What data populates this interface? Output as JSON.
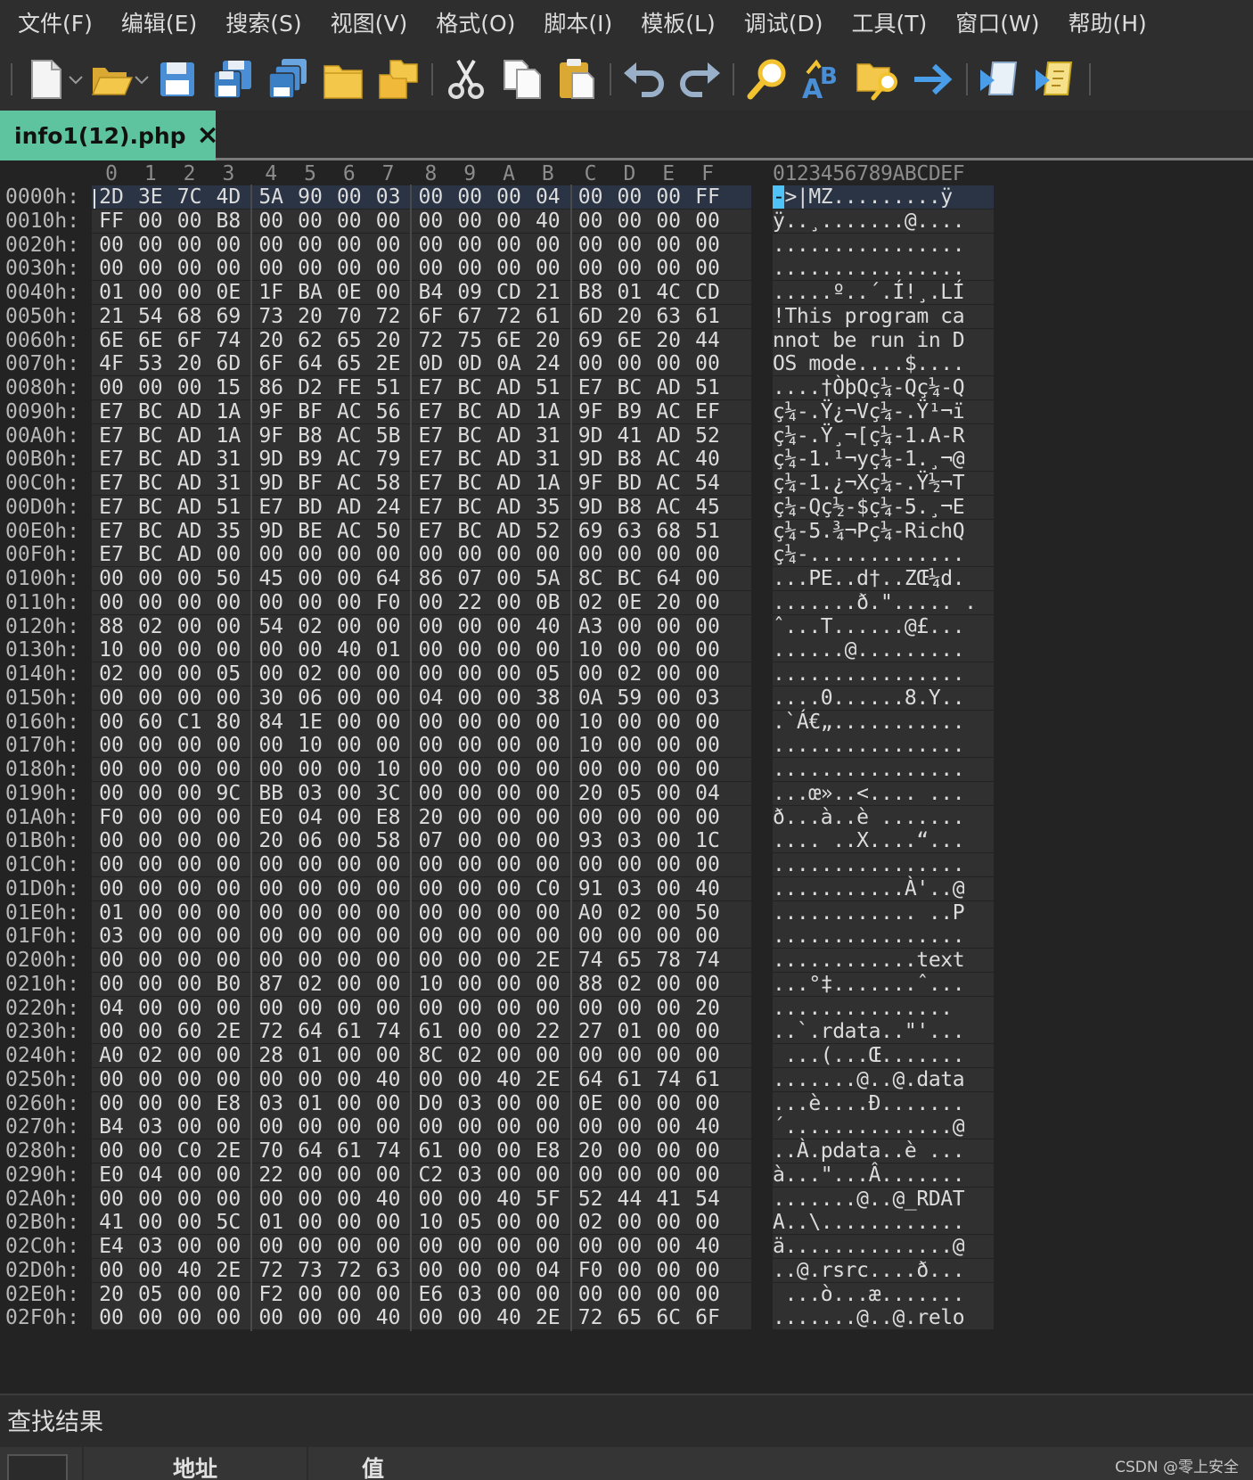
{
  "menu": [
    "文件(F)",
    "编辑(E)",
    "搜索(S)",
    "视图(V)",
    "格式(O)",
    "脚本(I)",
    "模板(L)",
    "调试(D)",
    "工具(T)",
    "窗口(W)",
    "帮助(H)"
  ],
  "toolbar": {
    "icons": [
      "new-file-icon",
      "open-folder-icon",
      "save-icon",
      "save-as-icon",
      "save-all-icon",
      "folder-icon",
      "open-project-icon",
      "cut-icon",
      "copy-icon",
      "paste-icon",
      "undo-icon",
      "redo-icon",
      "find-icon",
      "replace-icon",
      "find-in-files-icon",
      "goto-icon",
      "run-script-icon",
      "run-template-icon"
    ]
  },
  "tab": {
    "label": "info1(12).php",
    "close": "×"
  },
  "hex": {
    "col_headers": [
      "0",
      "1",
      "2",
      "3",
      "4",
      "5",
      "6",
      "7",
      "8",
      "9",
      "A",
      "B",
      "C",
      "D",
      "E",
      "F"
    ],
    "ascii_header": "0123456789ABCDEF",
    "rows": [
      {
        "addr": "0000h:",
        "bytes": [
          "2D",
          "3E",
          "7C",
          "4D",
          "5A",
          "90",
          "00",
          "03",
          "00",
          "00",
          "00",
          "04",
          "00",
          "00",
          "00",
          "FF"
        ],
        "ascii": "->|MZ.........ÿ"
      },
      {
        "addr": "0010h:",
        "bytes": [
          "FF",
          "00",
          "00",
          "B8",
          "00",
          "00",
          "00",
          "00",
          "00",
          "00",
          "00",
          "40",
          "00",
          "00",
          "00",
          "00"
        ],
        "ascii": "ÿ..¸.......@...."
      },
      {
        "addr": "0020h:",
        "bytes": [
          "00",
          "00",
          "00",
          "00",
          "00",
          "00",
          "00",
          "00",
          "00",
          "00",
          "00",
          "00",
          "00",
          "00",
          "00",
          "00"
        ],
        "ascii": "................"
      },
      {
        "addr": "0030h:",
        "bytes": [
          "00",
          "00",
          "00",
          "00",
          "00",
          "00",
          "00",
          "00",
          "00",
          "00",
          "00",
          "00",
          "00",
          "00",
          "00",
          "00"
        ],
        "ascii": "................"
      },
      {
        "addr": "0040h:",
        "bytes": [
          "01",
          "00",
          "00",
          "0E",
          "1F",
          "BA",
          "0E",
          "00",
          "B4",
          "09",
          "CD",
          "21",
          "B8",
          "01",
          "4C",
          "CD"
        ],
        "ascii": ".....º..´.Í!¸.LÍ"
      },
      {
        "addr": "0050h:",
        "bytes": [
          "21",
          "54",
          "68",
          "69",
          "73",
          "20",
          "70",
          "72",
          "6F",
          "67",
          "72",
          "61",
          "6D",
          "20",
          "63",
          "61"
        ],
        "ascii": "!This program ca"
      },
      {
        "addr": "0060h:",
        "bytes": [
          "6E",
          "6E",
          "6F",
          "74",
          "20",
          "62",
          "65",
          "20",
          "72",
          "75",
          "6E",
          "20",
          "69",
          "6E",
          "20",
          "44"
        ],
        "ascii": "nnot be run in D"
      },
      {
        "addr": "0070h:",
        "bytes": [
          "4F",
          "53",
          "20",
          "6D",
          "6F",
          "64",
          "65",
          "2E",
          "0D",
          "0D",
          "0A",
          "24",
          "00",
          "00",
          "00",
          "00"
        ],
        "ascii": "OS mode....$...."
      },
      {
        "addr": "0080h:",
        "bytes": [
          "00",
          "00",
          "00",
          "15",
          "86",
          "D2",
          "FE",
          "51",
          "E7",
          "BC",
          "AD",
          "51",
          "E7",
          "BC",
          "AD",
          "51"
        ],
        "ascii": "....†ÒþQç¼-Qç¼-Q"
      },
      {
        "addr": "0090h:",
        "bytes": [
          "E7",
          "BC",
          "AD",
          "1A",
          "9F",
          "BF",
          "AC",
          "56",
          "E7",
          "BC",
          "AD",
          "1A",
          "9F",
          "B9",
          "AC",
          "EF"
        ],
        "ascii": "ç¼-.Ÿ¿¬Vç¼-.Ÿ¹¬ï"
      },
      {
        "addr": "00A0h:",
        "bytes": [
          "E7",
          "BC",
          "AD",
          "1A",
          "9F",
          "B8",
          "AC",
          "5B",
          "E7",
          "BC",
          "AD",
          "31",
          "9D",
          "41",
          "AD",
          "52"
        ],
        "ascii": "ç¼-.Ÿ¸¬[ç¼-1.A-R"
      },
      {
        "addr": "00B0h:",
        "bytes": [
          "E7",
          "BC",
          "AD",
          "31",
          "9D",
          "B9",
          "AC",
          "79",
          "E7",
          "BC",
          "AD",
          "31",
          "9D",
          "B8",
          "AC",
          "40"
        ],
        "ascii": "ç¼-1.¹¬yç¼-1.¸¬@"
      },
      {
        "addr": "00C0h:",
        "bytes": [
          "E7",
          "BC",
          "AD",
          "31",
          "9D",
          "BF",
          "AC",
          "58",
          "E7",
          "BC",
          "AD",
          "1A",
          "9F",
          "BD",
          "AC",
          "54"
        ],
        "ascii": "ç¼-1.¿¬Xç¼-.Ÿ½¬T"
      },
      {
        "addr": "00D0h:",
        "bytes": [
          "E7",
          "BC",
          "AD",
          "51",
          "E7",
          "BD",
          "AD",
          "24",
          "E7",
          "BC",
          "AD",
          "35",
          "9D",
          "B8",
          "AC",
          "45"
        ],
        "ascii": "ç¼-Qç½-$ç¼-5.¸¬E"
      },
      {
        "addr": "00E0h:",
        "bytes": [
          "E7",
          "BC",
          "AD",
          "35",
          "9D",
          "BE",
          "AC",
          "50",
          "E7",
          "BC",
          "AD",
          "52",
          "69",
          "63",
          "68",
          "51"
        ],
        "ascii": "ç¼-5.¾¬Pç¼-RichQ"
      },
      {
        "addr": "00F0h:",
        "bytes": [
          "E7",
          "BC",
          "AD",
          "00",
          "00",
          "00",
          "00",
          "00",
          "00",
          "00",
          "00",
          "00",
          "00",
          "00",
          "00",
          "00"
        ],
        "ascii": "ç¼-............."
      },
      {
        "addr": "0100h:",
        "bytes": [
          "00",
          "00",
          "00",
          "50",
          "45",
          "00",
          "00",
          "64",
          "86",
          "07",
          "00",
          "5A",
          "8C",
          "BC",
          "64",
          "00"
        ],
        "ascii": "...PE..d†..ZŒ¼d."
      },
      {
        "addr": "0110h:",
        "bytes": [
          "00",
          "00",
          "00",
          "00",
          "00",
          "00",
          "00",
          "F0",
          "00",
          "22",
          "00",
          "0B",
          "02",
          "0E",
          "20",
          "00"
        ],
        "ascii": ".......ð.\"..... ."
      },
      {
        "addr": "0120h:",
        "bytes": [
          "88",
          "02",
          "00",
          "00",
          "54",
          "02",
          "00",
          "00",
          "00",
          "00",
          "00",
          "40",
          "A3",
          "00",
          "00",
          "00"
        ],
        "ascii": "ˆ...T......@£..."
      },
      {
        "addr": "0130h:",
        "bytes": [
          "10",
          "00",
          "00",
          "00",
          "00",
          "00",
          "40",
          "01",
          "00",
          "00",
          "00",
          "00",
          "10",
          "00",
          "00",
          "00"
        ],
        "ascii": "......@........."
      },
      {
        "addr": "0140h:",
        "bytes": [
          "02",
          "00",
          "00",
          "05",
          "00",
          "02",
          "00",
          "00",
          "00",
          "00",
          "00",
          "05",
          "00",
          "02",
          "00",
          "00"
        ],
        "ascii": "................"
      },
      {
        "addr": "0150h:",
        "bytes": [
          "00",
          "00",
          "00",
          "00",
          "30",
          "06",
          "00",
          "00",
          "04",
          "00",
          "00",
          "38",
          "0A",
          "59",
          "00",
          "03"
        ],
        "ascii": "....0......8.Y.."
      },
      {
        "addr": "0160h:",
        "bytes": [
          "00",
          "60",
          "C1",
          "80",
          "84",
          "1E",
          "00",
          "00",
          "00",
          "00",
          "00",
          "00",
          "10",
          "00",
          "00",
          "00"
        ],
        "ascii": ".`Á€„..........."
      },
      {
        "addr": "0170h:",
        "bytes": [
          "00",
          "00",
          "00",
          "00",
          "00",
          "10",
          "00",
          "00",
          "00",
          "00",
          "00",
          "00",
          "10",
          "00",
          "00",
          "00"
        ],
        "ascii": "................"
      },
      {
        "addr": "0180h:",
        "bytes": [
          "00",
          "00",
          "00",
          "00",
          "00",
          "00",
          "00",
          "10",
          "00",
          "00",
          "00",
          "00",
          "00",
          "00",
          "00",
          "00"
        ],
        "ascii": "................"
      },
      {
        "addr": "0190h:",
        "bytes": [
          "00",
          "00",
          "00",
          "9C",
          "BB",
          "03",
          "00",
          "3C",
          "00",
          "00",
          "00",
          "00",
          "20",
          "05",
          "00",
          "04"
        ],
        "ascii": "...œ»..<.... ..."
      },
      {
        "addr": "01A0h:",
        "bytes": [
          "F0",
          "00",
          "00",
          "00",
          "E0",
          "04",
          "00",
          "E8",
          "20",
          "00",
          "00",
          "00",
          "00",
          "00",
          "00",
          "00"
        ],
        "ascii": "ð...à..è ......."
      },
      {
        "addr": "01B0h:",
        "bytes": [
          "00",
          "00",
          "00",
          "00",
          "20",
          "06",
          "00",
          "58",
          "07",
          "00",
          "00",
          "00",
          "93",
          "03",
          "00",
          "1C"
        ],
        "ascii": ".... ..X....“..."
      },
      {
        "addr": "01C0h:",
        "bytes": [
          "00",
          "00",
          "00",
          "00",
          "00",
          "00",
          "00",
          "00",
          "00",
          "00",
          "00",
          "00",
          "00",
          "00",
          "00",
          "00"
        ],
        "ascii": "................"
      },
      {
        "addr": "01D0h:",
        "bytes": [
          "00",
          "00",
          "00",
          "00",
          "00",
          "00",
          "00",
          "00",
          "00",
          "00",
          "00",
          "C0",
          "91",
          "03",
          "00",
          "40"
        ],
        "ascii": "...........À'..@"
      },
      {
        "addr": "01E0h:",
        "bytes": [
          "01",
          "00",
          "00",
          "00",
          "00",
          "00",
          "00",
          "00",
          "00",
          "00",
          "00",
          "00",
          "A0",
          "02",
          "00",
          "50"
        ],
        "ascii": "............ ..P"
      },
      {
        "addr": "01F0h:",
        "bytes": [
          "03",
          "00",
          "00",
          "00",
          "00",
          "00",
          "00",
          "00",
          "00",
          "00",
          "00",
          "00",
          "00",
          "00",
          "00",
          "00"
        ],
        "ascii": "................"
      },
      {
        "addr": "0200h:",
        "bytes": [
          "00",
          "00",
          "00",
          "00",
          "00",
          "00",
          "00",
          "00",
          "00",
          "00",
          "00",
          "2E",
          "74",
          "65",
          "78",
          "74"
        ],
        "ascii": "............text"
      },
      {
        "addr": "0210h:",
        "bytes": [
          "00",
          "00",
          "00",
          "B0",
          "87",
          "02",
          "00",
          "00",
          "10",
          "00",
          "00",
          "00",
          "88",
          "02",
          "00",
          "00"
        ],
        "ascii": "...°‡.......ˆ..."
      },
      {
        "addr": "0220h:",
        "bytes": [
          "04",
          "00",
          "00",
          "00",
          "00",
          "00",
          "00",
          "00",
          "00",
          "00",
          "00",
          "00",
          "00",
          "00",
          "00",
          "20"
        ],
        "ascii": "............... "
      },
      {
        "addr": "0230h:",
        "bytes": [
          "00",
          "00",
          "60",
          "2E",
          "72",
          "64",
          "61",
          "74",
          "61",
          "00",
          "00",
          "22",
          "27",
          "01",
          "00",
          "00"
        ],
        "ascii": "..`.rdata..\"'..."
      },
      {
        "addr": "0240h:",
        "bytes": [
          "A0",
          "02",
          "00",
          "00",
          "28",
          "01",
          "00",
          "00",
          "8C",
          "02",
          "00",
          "00",
          "00",
          "00",
          "00",
          "00"
        ],
        "ascii": " ...(...Œ......."
      },
      {
        "addr": "0250h:",
        "bytes": [
          "00",
          "00",
          "00",
          "00",
          "00",
          "00",
          "00",
          "40",
          "00",
          "00",
          "40",
          "2E",
          "64",
          "61",
          "74",
          "61"
        ],
        "ascii": ".......@..@.data"
      },
      {
        "addr": "0260h:",
        "bytes": [
          "00",
          "00",
          "00",
          "E8",
          "03",
          "01",
          "00",
          "00",
          "D0",
          "03",
          "00",
          "00",
          "0E",
          "00",
          "00",
          "00"
        ],
        "ascii": "...è....Ð......."
      },
      {
        "addr": "0270h:",
        "bytes": [
          "B4",
          "03",
          "00",
          "00",
          "00",
          "00",
          "00",
          "00",
          "00",
          "00",
          "00",
          "00",
          "00",
          "00",
          "00",
          "40"
        ],
        "ascii": "´..............@"
      },
      {
        "addr": "0280h:",
        "bytes": [
          "00",
          "00",
          "C0",
          "2E",
          "70",
          "64",
          "61",
          "74",
          "61",
          "00",
          "00",
          "E8",
          "20",
          "00",
          "00",
          "00"
        ],
        "ascii": "..À.pdata..è ..."
      },
      {
        "addr": "0290h:",
        "bytes": [
          "E0",
          "04",
          "00",
          "00",
          "22",
          "00",
          "00",
          "00",
          "C2",
          "03",
          "00",
          "00",
          "00",
          "00",
          "00",
          "00"
        ],
        "ascii": "à...\"...Â......."
      },
      {
        "addr": "02A0h:",
        "bytes": [
          "00",
          "00",
          "00",
          "00",
          "00",
          "00",
          "00",
          "40",
          "00",
          "00",
          "40",
          "5F",
          "52",
          "44",
          "41",
          "54"
        ],
        "ascii": ".......@..@_RDAT"
      },
      {
        "addr": "02B0h:",
        "bytes": [
          "41",
          "00",
          "00",
          "5C",
          "01",
          "00",
          "00",
          "00",
          "10",
          "05",
          "00",
          "00",
          "02",
          "00",
          "00",
          "00"
        ],
        "ascii": "A..\\............"
      },
      {
        "addr": "02C0h:",
        "bytes": [
          "E4",
          "03",
          "00",
          "00",
          "00",
          "00",
          "00",
          "00",
          "00",
          "00",
          "00",
          "00",
          "00",
          "00",
          "00",
          "40"
        ],
        "ascii": "ä..............@"
      },
      {
        "addr": "02D0h:",
        "bytes": [
          "00",
          "00",
          "40",
          "2E",
          "72",
          "73",
          "72",
          "63",
          "00",
          "00",
          "00",
          "04",
          "F0",
          "00",
          "00",
          "00"
        ],
        "ascii": "..@.rsrc....ð..."
      },
      {
        "addr": "02E0h:",
        "bytes": [
          "20",
          "05",
          "00",
          "00",
          "F2",
          "00",
          "00",
          "00",
          "E6",
          "03",
          "00",
          "00",
          "00",
          "00",
          "00",
          "00"
        ],
        "ascii": " ...ò...æ......."
      },
      {
        "addr": "02F0h:",
        "bytes": [
          "00",
          "00",
          "00",
          "00",
          "00",
          "00",
          "00",
          "40",
          "00",
          "00",
          "40",
          "2E",
          "72",
          "65",
          "6C",
          "6F"
        ],
        "ascii": ".......@..@.relo"
      }
    ]
  },
  "find": {
    "title": "查找结果",
    "columns": [
      "地址",
      "值"
    ]
  },
  "watermark": "CSDN @零上安全",
  "colors": {
    "tab_active": "#5ec4a0",
    "cursor": "#4fc3f7"
  }
}
